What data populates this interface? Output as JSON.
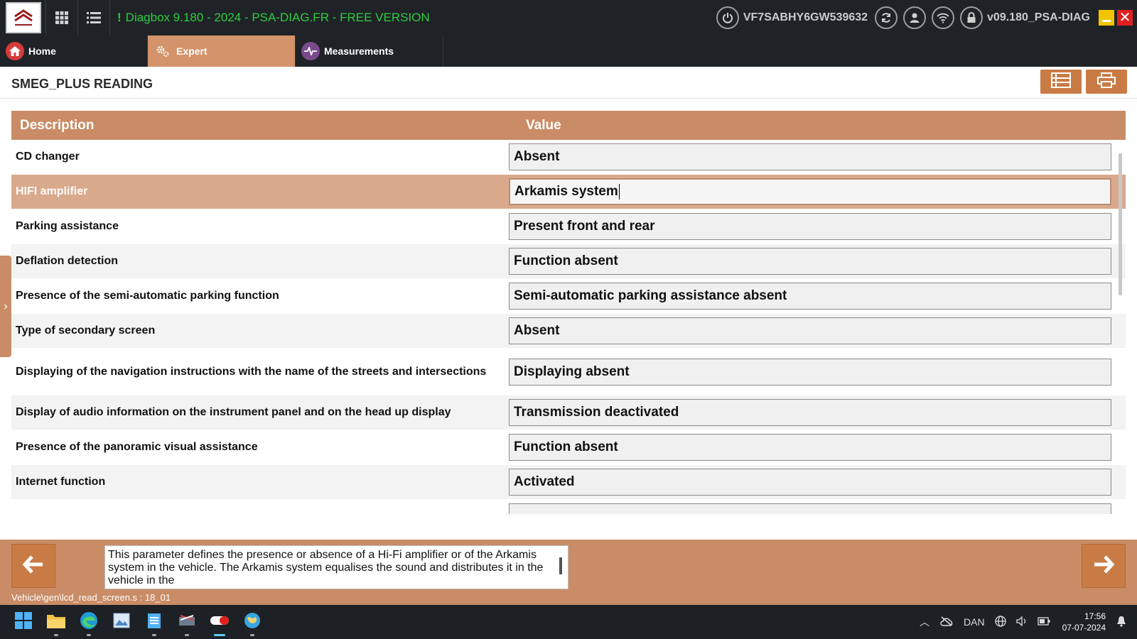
{
  "topbar": {
    "title_bang": "!",
    "title": "Diagbox 9.180 - 2024 - PSA-DIAG.FR - FREE VERSION",
    "vin": "VF7SABHY6GW539632",
    "version": "v09.180_PSA-DIAG",
    "title_color": "#2ecc40"
  },
  "tabs": [
    {
      "label": "Home",
      "icon": "home-icon"
    },
    {
      "label": "Expert",
      "icon": "gears-icon"
    },
    {
      "label": "Measurements",
      "icon": "pulse-icon"
    }
  ],
  "page": {
    "title": "SMEG_PLUS READING"
  },
  "table": {
    "headers": {
      "description": "Description",
      "value": "Value"
    },
    "rows": [
      {
        "description": "CD changer",
        "value": "Absent"
      },
      {
        "description": "HIFI amplifier",
        "value": "Arkamis system"
      },
      {
        "description": "Parking assistance",
        "value": "Present front and rear"
      },
      {
        "description": "Deflation detection",
        "value": "Function absent"
      },
      {
        "description": "Presence of the semi-automatic parking function",
        "value": "Semi-automatic parking assistance absent"
      },
      {
        "description": "Type of secondary screen",
        "value": "Absent"
      },
      {
        "description": "Displaying of the navigation instructions with the name of the streets and intersections",
        "value": "Displaying absent"
      },
      {
        "description": "Display of audio information on the instrument panel and on the head up display",
        "value": "Transmission deactivated"
      },
      {
        "description": "Presence of the panoramic visual assistance",
        "value": "Function absent"
      },
      {
        "description": "Internet function",
        "value": "Activated"
      }
    ],
    "selected_index": 1
  },
  "help": {
    "text": "This parameter defines the presence or absence of a Hi-Fi amplifier or of the Arkamis system in the vehicle. The Arkamis system equalises the sound and distributes it in the vehicle in the"
  },
  "footer": {
    "script_path": "Vehicle\\gen\\lcd_read_screen.s : 18_01"
  },
  "taskbar": {
    "language": "DAN",
    "time": "17:56",
    "date": "07-07-2024"
  },
  "colors": {
    "accent": "#c98c66",
    "button": "#c97b45",
    "selected_row": "#d9a98c"
  }
}
